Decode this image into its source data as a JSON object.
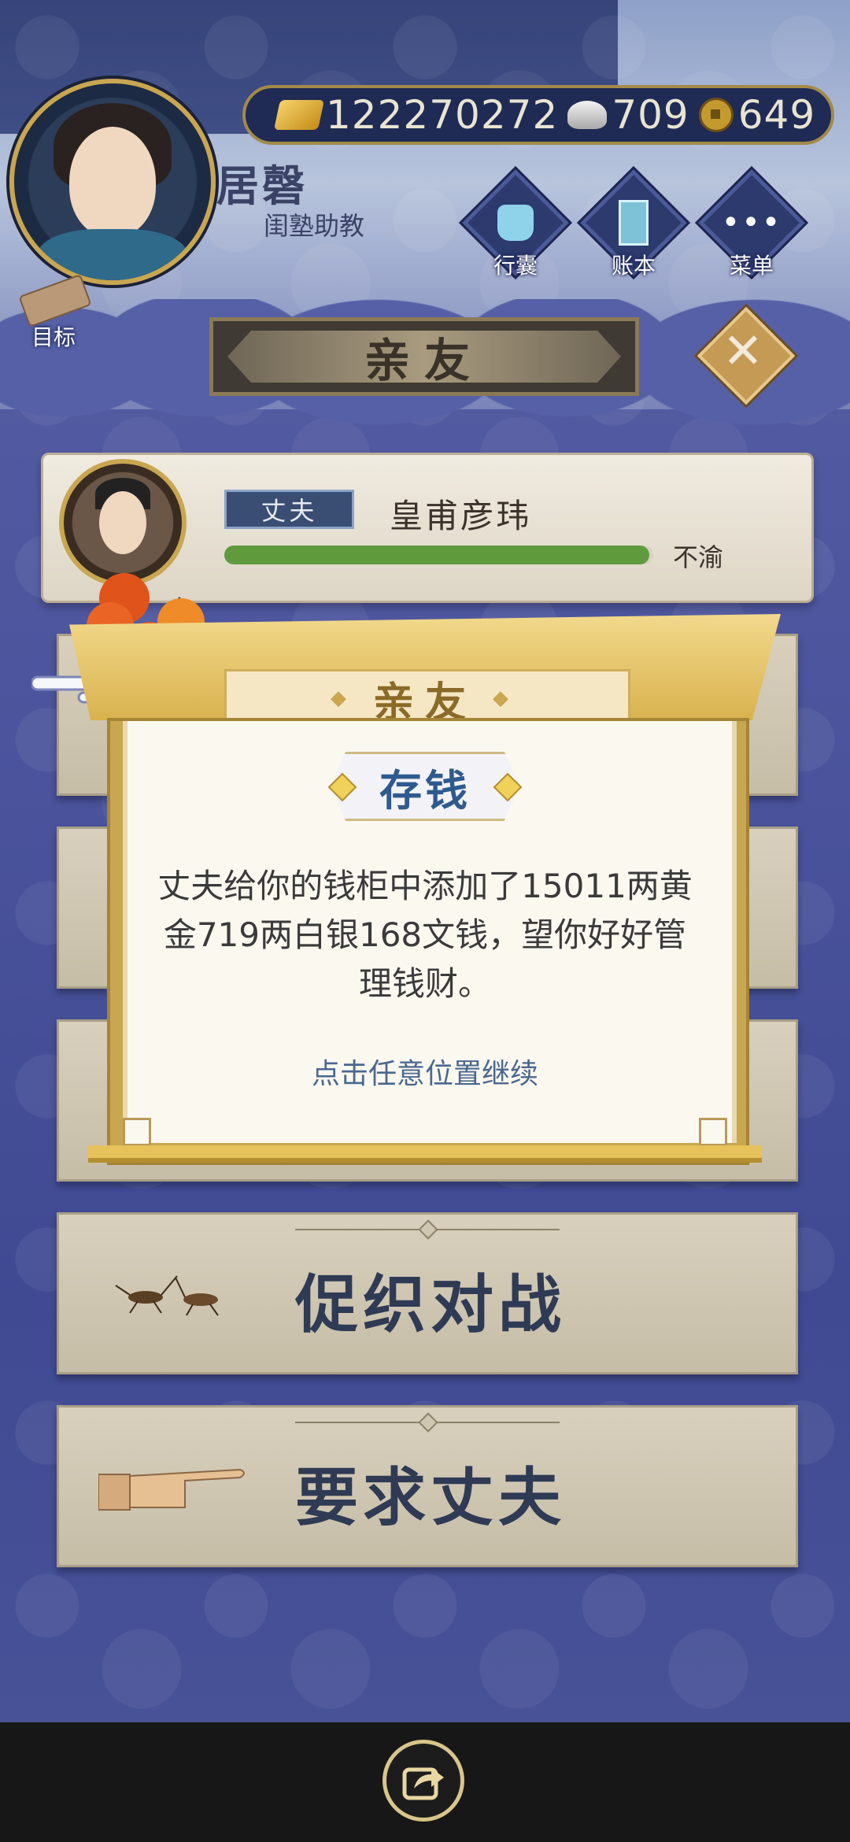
{
  "player": {
    "name": "居磬",
    "title": "闺塾助教"
  },
  "currency": {
    "gold": "122270272",
    "silver": "709",
    "copper": "649"
  },
  "menu_buttons": [
    {
      "label": "行囊",
      "icon": "bag-icon"
    },
    {
      "label": "账本",
      "icon": "ledger-icon"
    },
    {
      "label": "菜单",
      "icon": "more-icon"
    }
  ],
  "target": {
    "label": "目标"
  },
  "page": {
    "title": "亲友"
  },
  "relative": {
    "role": "丈夫",
    "name": "皇甫彦玮",
    "status": "不渝",
    "affection_fraction": 0.99
  },
  "actions": [
    {
      "label": "促织对战",
      "icon": "cricket-icon"
    },
    {
      "label": "要求丈夫",
      "icon": "pointing-hand-icon"
    }
  ],
  "dialog": {
    "header": "亲友",
    "badge": "存钱",
    "body": "丈夫给你的钱柜中添加了15011两黄金719两白银168文钱，望你好好管理钱财。",
    "hint": "点击任意位置继续"
  },
  "colors": {
    "background": "#4b549c",
    "gold_accent": "#c9a650",
    "affection_bar": "#5f9a3d",
    "badge_text": "#2f5a8e"
  }
}
